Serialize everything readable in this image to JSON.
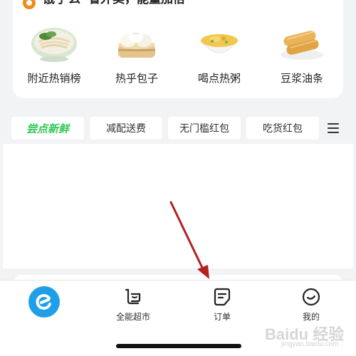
{
  "brand": {
    "name": "饿了么",
    "slogan": "省外卖，能量加倍"
  },
  "categories": [
    {
      "label": "附近热销榜",
      "icon": "noodle-bowl-icon"
    },
    {
      "label": "热乎包子",
      "icon": "steamed-bun-icon"
    },
    {
      "label": "喝点热粥",
      "icon": "porridge-bowl-icon"
    },
    {
      "label": "豆浆油条",
      "icon": "fried-dough-icon"
    }
  ],
  "filters": {
    "chips": [
      "尝点新鲜",
      "减配送费",
      "无门槛红包",
      "吃货红包"
    ],
    "menu_icon": "menu-icon",
    "accent_color": "#35c85a"
  },
  "bottom_nav": {
    "items": [
      {
        "label": "",
        "icon": "eleme-home-logo"
      },
      {
        "label": "全能超市",
        "icon": "shopping-basket-icon"
      },
      {
        "label": "订单",
        "icon": "order-list-icon"
      },
      {
        "label": "我的",
        "icon": "smile-face-icon"
      }
    ],
    "accent_color": "#1f9fe8"
  },
  "watermark": {
    "text": "Baidu 经验",
    "sub": "jingyan.baidu.com"
  },
  "annotation": {
    "arrow_color": "#b22222"
  }
}
